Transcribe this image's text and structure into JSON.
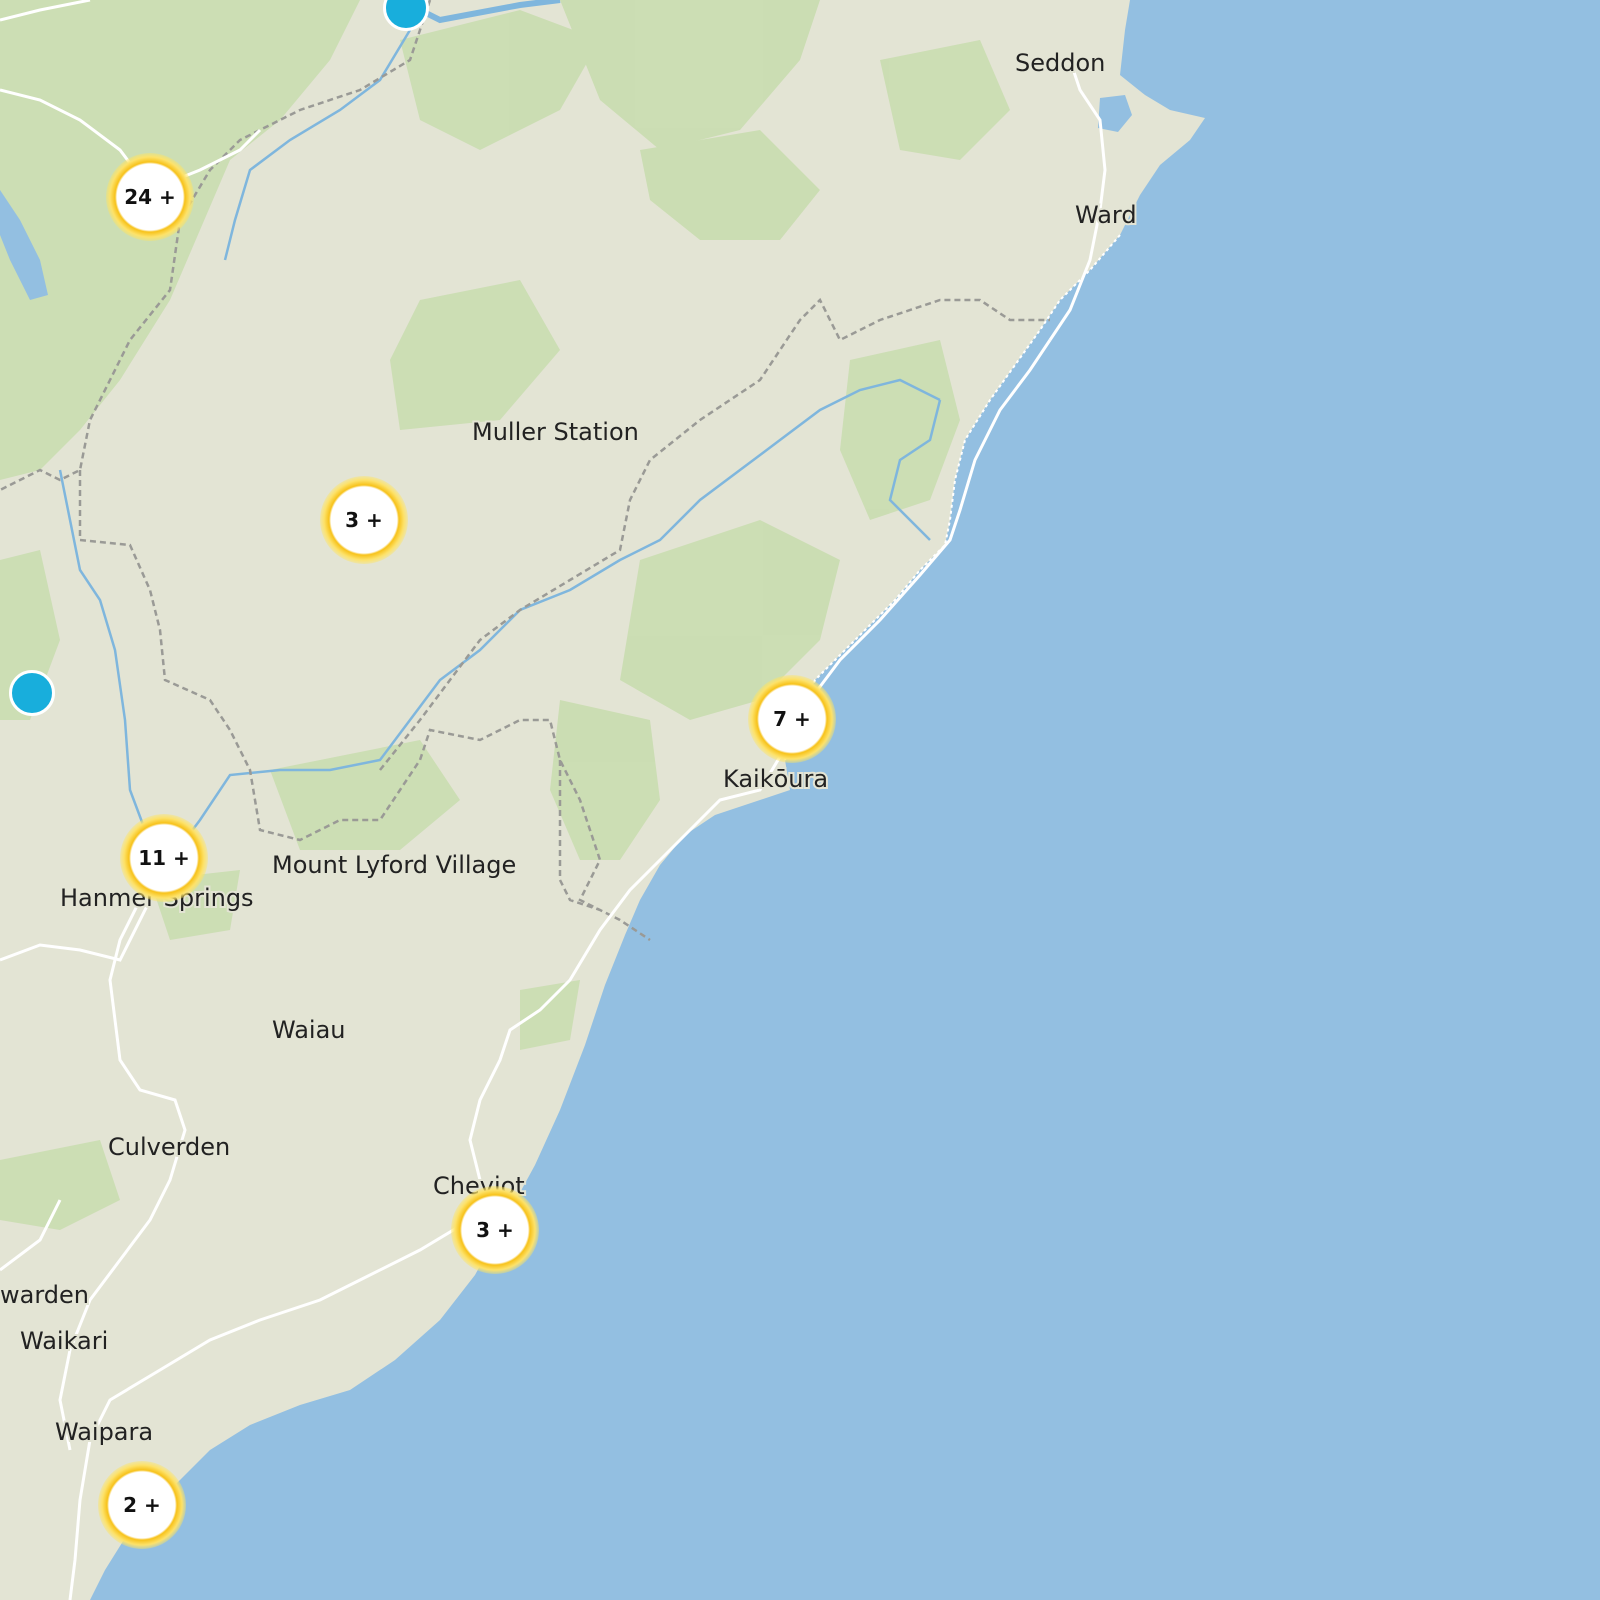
{
  "map": {
    "colors": {
      "land": "#e3e4d4",
      "sea": "#93bfe1",
      "forest": "#c9ddb0",
      "road": "#ffffff",
      "boundary": "#9a9a96",
      "river": "#7fb6dd"
    },
    "places": [
      {
        "id": "seddon",
        "label": "Seddon"
      },
      {
        "id": "ward",
        "label": "Ward"
      },
      {
        "id": "muller",
        "label": "Muller Station"
      },
      {
        "id": "kaikoura",
        "label": "Kaikōura"
      },
      {
        "id": "mount-lyford",
        "label": "Mount Lyford Village"
      },
      {
        "id": "hanmer",
        "label": "Hanmer Springs"
      },
      {
        "id": "waiau",
        "label": "Waiau"
      },
      {
        "id": "culverden",
        "label": "Culverden"
      },
      {
        "id": "cheviot",
        "label": "Cheviot"
      },
      {
        "id": "hawarden",
        "label": "warden"
      },
      {
        "id": "waikari",
        "label": "Waikari"
      },
      {
        "id": "waipara",
        "label": "Waipara"
      }
    ],
    "clusters": [
      {
        "id": "c24",
        "label": "24 +"
      },
      {
        "id": "c3a",
        "label": "3 +"
      },
      {
        "id": "c7",
        "label": "7 +"
      },
      {
        "id": "c11",
        "label": "11 +"
      },
      {
        "id": "c3b",
        "label": "3 +"
      },
      {
        "id": "c2",
        "label": "2 +"
      }
    ],
    "pins": [
      {
        "id": "pin-north",
        "icon": "location-marker-icon"
      },
      {
        "id": "pin-west",
        "icon": "location-marker-icon"
      }
    ]
  }
}
